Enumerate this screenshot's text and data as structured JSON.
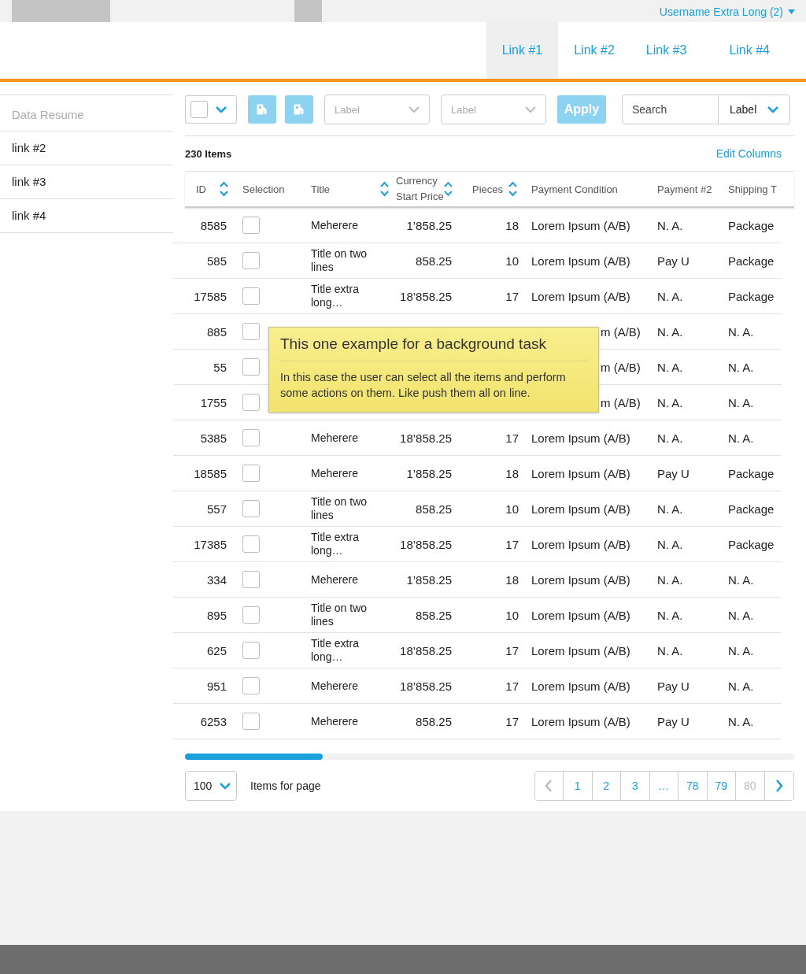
{
  "top_bar": {
    "user_menu": "Username Extra Long (2)"
  },
  "nav": [
    {
      "label": "Link #1",
      "selected": true
    },
    {
      "label": "Link #2",
      "selected": false
    },
    {
      "label": "Link #3",
      "selected": false
    },
    {
      "label": "Link #4",
      "selected": false
    }
  ],
  "sidebar": {
    "title": "Data Resume",
    "items": [
      "link #2",
      "link #3",
      "link #4"
    ]
  },
  "toolbar": {
    "select_all": {
      "checked": false
    },
    "filters": [
      {
        "placeholder": "Label"
      },
      {
        "placeholder": "Label"
      }
    ],
    "apply": "Apply",
    "search": {
      "placeholder": "Search",
      "scope": "Label"
    }
  },
  "table": {
    "count": "230 Items",
    "edit_columns": "Edit Columns",
    "columns": [
      {
        "label": "ID",
        "sortable": true
      },
      {
        "label": "Selection",
        "sortable": false
      },
      {
        "label": "Title",
        "sortable": true
      },
      {
        "label": "Currency Start Price",
        "sortable": true
      },
      {
        "label": "Pieces",
        "sortable": true
      },
      {
        "label": "Payment Condition",
        "sortable": false
      },
      {
        "label": "Payment #2",
        "sortable": false
      },
      {
        "label": "Shipping T",
        "sortable": false
      }
    ],
    "rows": [
      {
        "kind": "full",
        "id": "8585",
        "checked": false,
        "title": "Meherere",
        "price": "1’858.25",
        "pieces": "18",
        "payment": "Lorem Ipsum (A/B)",
        "payment_2": "N. A.",
        "shipping": "Package"
      },
      {
        "kind": "full",
        "id": "585",
        "checked": false,
        "title": "Title on two lines",
        "price": "858.25",
        "pieces": "10",
        "payment": "Lorem Ipsum (A/B)",
        "payment_2": "Pay U",
        "shipping": "Package"
      },
      {
        "kind": "full",
        "id": "17585",
        "checked": false,
        "title": "Title extra long…",
        "price": "18’858.25",
        "pieces": "17",
        "payment": "Lorem Ipsum (A/B)",
        "payment_2": "N. A.",
        "shipping": "Package"
      },
      {
        "kind": "covered",
        "id": "885",
        "checked": false,
        "payment": "m (A/B)",
        "payment_2": "N. A.",
        "shipping": "N. A."
      },
      {
        "kind": "covered",
        "id": "55",
        "checked": false,
        "payment": "m (A/B)",
        "payment_2": "N. A.",
        "shipping": "N. A."
      },
      {
        "kind": "covered",
        "id": "1755",
        "checked": false,
        "payment": "m (A/B)",
        "payment_2": "N. A.",
        "shipping": "N. A."
      },
      {
        "kind": "full",
        "id": "5385",
        "checked": false,
        "title": "Meherere",
        "price": "18’858.25",
        "pieces": "17",
        "payment": "Lorem Ipsum (A/B)",
        "payment_2": "N. A.",
        "shipping": "N. A."
      },
      {
        "kind": "full",
        "id": "18585",
        "checked": false,
        "title": "Meherere",
        "price": "1’858.25",
        "pieces": "18",
        "payment": "Lorem Ipsum (A/B)",
        "payment_2": "Pay U",
        "shipping": "Package"
      },
      {
        "kind": "full",
        "id": "557",
        "checked": false,
        "title": "Title on two lines",
        "price": "858.25",
        "pieces": "10",
        "payment": "Lorem Ipsum (A/B)",
        "payment_2": "N. A.",
        "shipping": "Package"
      },
      {
        "kind": "full",
        "id": "17385",
        "checked": false,
        "title": "Title extra long…",
        "price": "18’858.25",
        "pieces": "17",
        "payment": "Lorem Ipsum (A/B)",
        "payment_2": "N. A.",
        "shipping": "Package"
      },
      {
        "kind": "full",
        "id": "334",
        "checked": false,
        "title": "Meherere",
        "price": "1’858.25",
        "pieces": "18",
        "payment": "Lorem Ipsum (A/B)",
        "payment_2": "N. A.",
        "shipping": "N. A."
      },
      {
        "kind": "full",
        "id": "895",
        "checked": false,
        "title": "Title on two lines",
        "price": "858.25",
        "pieces": "10",
        "payment": "Lorem Ipsum (A/B)",
        "payment_2": "N. A.",
        "shipping": "N. A."
      },
      {
        "kind": "full",
        "id": "625",
        "checked": false,
        "title": "Title extra long…",
        "price": "18’858.25",
        "pieces": "17",
        "payment": "Lorem Ipsum (A/B)",
        "payment_2": "N. A.",
        "shipping": "N. A."
      },
      {
        "kind": "full",
        "id": "951",
        "checked": false,
        "title": "Meherere",
        "price": "18’858.25",
        "pieces": "17",
        "payment": "Lorem Ipsum (A/B)",
        "payment_2": "Pay U",
        "shipping": "N. A."
      },
      {
        "kind": "full",
        "id": "6253",
        "checked": false,
        "title": "Meherere",
        "price": "858.25",
        "pieces": "17",
        "payment": "Lorem Ipsum (A/B)",
        "payment_2": "Pay U",
        "shipping": "N. A."
      }
    ]
  },
  "tooltip": {
    "title": "This one example for a background task",
    "body": "In this case the user can select all the items and perform some actions on them. Like push them all on line."
  },
  "footer": {
    "page_size": "100",
    "page_size_label": "Items for page",
    "pages": [
      {
        "kind": "prev",
        "disabled": true
      },
      {
        "kind": "page",
        "label": "1",
        "disabled": false
      },
      {
        "kind": "page",
        "label": "2",
        "disabled": false
      },
      {
        "kind": "page",
        "label": "3",
        "disabled": false
      },
      {
        "kind": "page",
        "label": "…",
        "disabled": false
      },
      {
        "kind": "page",
        "label": "78",
        "disabled": false
      },
      {
        "kind": "page",
        "label": "79",
        "disabled": false
      },
      {
        "kind": "page",
        "label": "80",
        "disabled": true
      },
      {
        "kind": "next",
        "disabled": false
      }
    ]
  }
}
